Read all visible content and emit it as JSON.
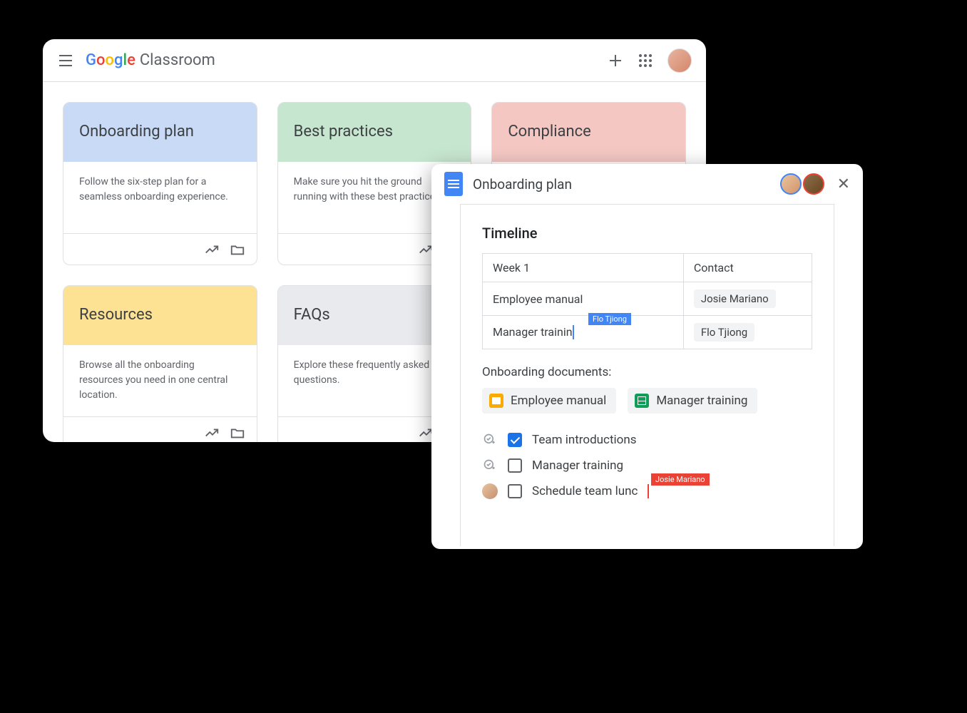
{
  "header": {
    "product": "Classroom",
    "google": {
      "g1": "G",
      "o1": "o",
      "o2": "o",
      "g2": "g",
      "l": "l",
      "e": "e"
    }
  },
  "cards": [
    {
      "title": "Onboarding plan",
      "body": "Follow the six-step plan for a seamless onboarding experience.",
      "color": "c-blue"
    },
    {
      "title": "Best practices",
      "body": "Make sure you hit the ground running with these best practices.",
      "color": "c-green"
    },
    {
      "title": "Compliance",
      "body": "",
      "color": "c-pink"
    },
    {
      "title": "Resources",
      "body": "Browse all the onboarding resources you need in one central location.",
      "color": "c-yellow"
    },
    {
      "title": "FAQs",
      "body": "Explore these frequently asked questions.",
      "color": "c-gray"
    }
  ],
  "doc": {
    "title": "Onboarding plan",
    "section": "Timeline",
    "table_head_left": "Week 1",
    "table_head_right": "Contact",
    "rows": [
      {
        "task": "Employee manual",
        "contact": "Josie Mariano"
      },
      {
        "task": "Manager trainin",
        "contact": "Flo Tjiong"
      }
    ],
    "cursor_tag_1": "Flo Tjiong",
    "docs_label": "Onboarding documents:",
    "doc_chips": [
      {
        "label": "Employee manual",
        "type": "slides"
      },
      {
        "label": "Manager training",
        "type": "sheets"
      }
    ],
    "checklist": [
      {
        "label": "Team introductions",
        "checked": true,
        "lead": "icon"
      },
      {
        "label": "Manager training",
        "checked": false,
        "lead": "icon"
      },
      {
        "label": "Schedule team lunc",
        "checked": false,
        "lead": "avatar"
      }
    ],
    "cursor_tag_2": "Josie Mariano"
  }
}
